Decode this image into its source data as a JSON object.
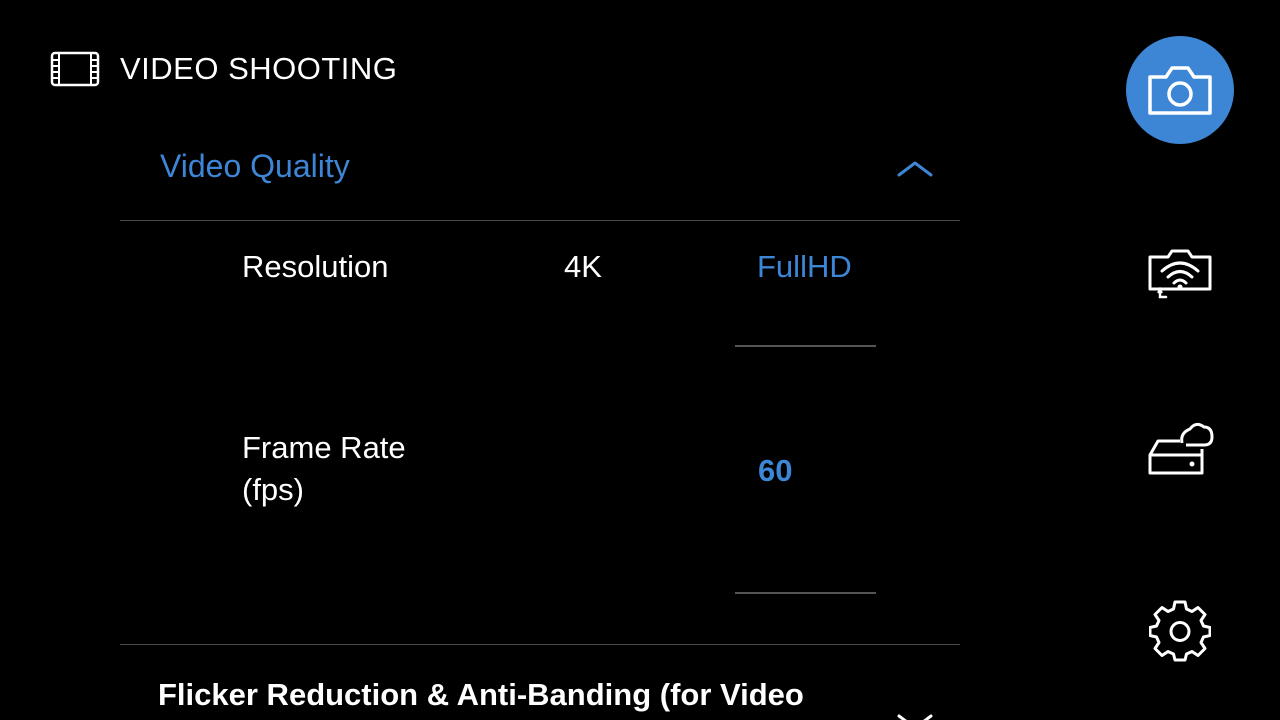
{
  "header": {
    "icon": "film-icon",
    "title": "VIDEO SHOOTING"
  },
  "section": {
    "title": "Video Quality",
    "expanded": true,
    "icon": "chevron-up-icon"
  },
  "settings": {
    "resolution": {
      "label": "Resolution",
      "options": [
        "4K",
        "FullHD"
      ],
      "selected": "FullHD"
    },
    "frame_rate": {
      "label_line1": "Frame Rate",
      "label_line2": "(fps)",
      "value": "60"
    }
  },
  "next_section": {
    "title": "Flicker Reduction & Anti-Banding (for Video",
    "icon": "chevron-down-icon"
  },
  "sidebar": {
    "items": [
      {
        "name": "camera",
        "icon": "camera-icon",
        "active": true
      },
      {
        "name": "wifi-camera",
        "icon": "wifi-camera-icon",
        "active": false
      },
      {
        "name": "cloud-storage",
        "icon": "cloud-storage-icon",
        "active": false
      },
      {
        "name": "settings",
        "icon": "gear-icon",
        "active": false
      }
    ]
  },
  "colors": {
    "accent": "#3d86d6",
    "background": "#000000",
    "text": "#ffffff",
    "divider": "#4a4a4a"
  }
}
